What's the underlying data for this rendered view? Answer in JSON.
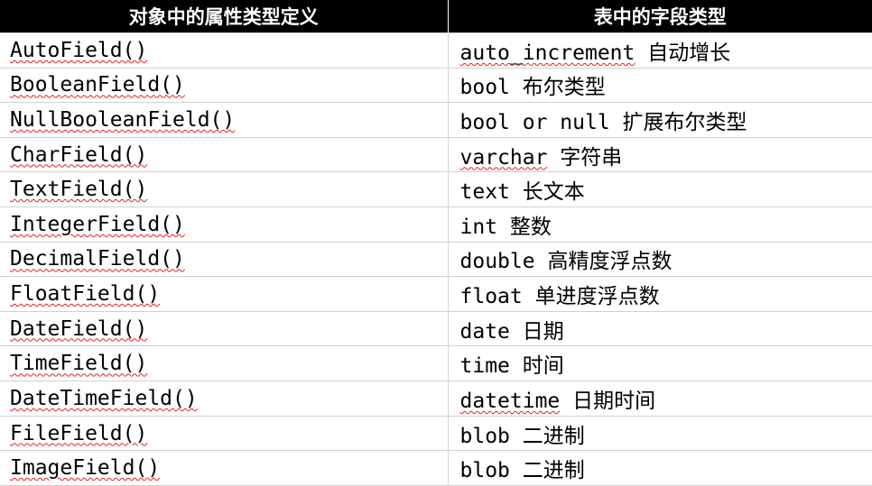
{
  "header": {
    "left": "对象中的属性类型定义",
    "right": "表中的字段类型"
  },
  "rows": [
    {
      "attr": "AutoField()",
      "sql": "auto_increment",
      "desc": "自动增长"
    },
    {
      "attr": "BooleanField()",
      "sql": "bool",
      "desc": "布尔类型"
    },
    {
      "attr": "NullBooleanField()",
      "sql": "bool or null",
      "desc": "扩展布尔类型"
    },
    {
      "attr": "CharField()",
      "sql": "varchar",
      "desc": "字符串"
    },
    {
      "attr": "TextField()",
      "sql": "text",
      "desc": "长文本"
    },
    {
      "attr": "IntegerField()",
      "sql": "int",
      "desc": "整数"
    },
    {
      "attr": "DecimalField()",
      "sql": "double",
      "desc": "高精度浮点数"
    },
    {
      "attr": "FloatField()",
      "sql": "float",
      "desc": "单进度浮点数"
    },
    {
      "attr": "DateField()",
      "sql": "date",
      "desc": "日期"
    },
    {
      "attr": "TimeField()",
      "sql": "time",
      "desc": "时间"
    },
    {
      "attr": "DateTimeField()",
      "sql": "datetime",
      "desc": "日期时间"
    },
    {
      "attr": "FileField()",
      "sql": "blob",
      "desc": "二进制"
    },
    {
      "attr": "ImageField()",
      "sql": "blob",
      "desc": "二进制"
    }
  ]
}
